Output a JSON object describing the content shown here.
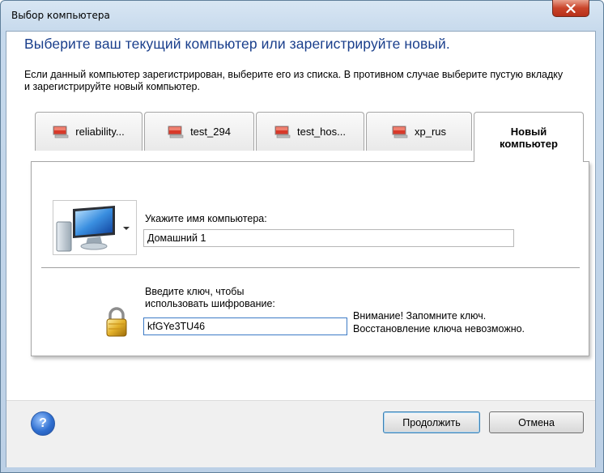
{
  "window": {
    "title": "Выбор компьютера"
  },
  "heading": "Выберите ваш текущий компьютер или зарегистрируйте новый.",
  "description": "Если данный компьютер зарегистрирован, выберите его из списка. В противном случае выберите пустую вкладку и зарегистрируйте новый компьютер.",
  "tabs": [
    {
      "label": "reliability..."
    },
    {
      "label": "test_294"
    },
    {
      "label": "test_hos..."
    },
    {
      "label": "xp_rus"
    },
    {
      "label_line1": "Новый",
      "label_line2": "компьютер",
      "active": true
    }
  ],
  "computer_name": {
    "label": "Укажите имя компьютера:",
    "value": "Домашний 1"
  },
  "encryption": {
    "label_line1": "Введите ключ, чтобы",
    "label_line2": "использовать шифрование:",
    "value": "kfGYe3TU46",
    "warning_line1": "Внимание! Запомните ключ.",
    "warning_line2": "Восстановление ключа невозможно."
  },
  "buttons": {
    "continue": "Продолжить",
    "cancel": "Отмена",
    "help": "?"
  }
}
